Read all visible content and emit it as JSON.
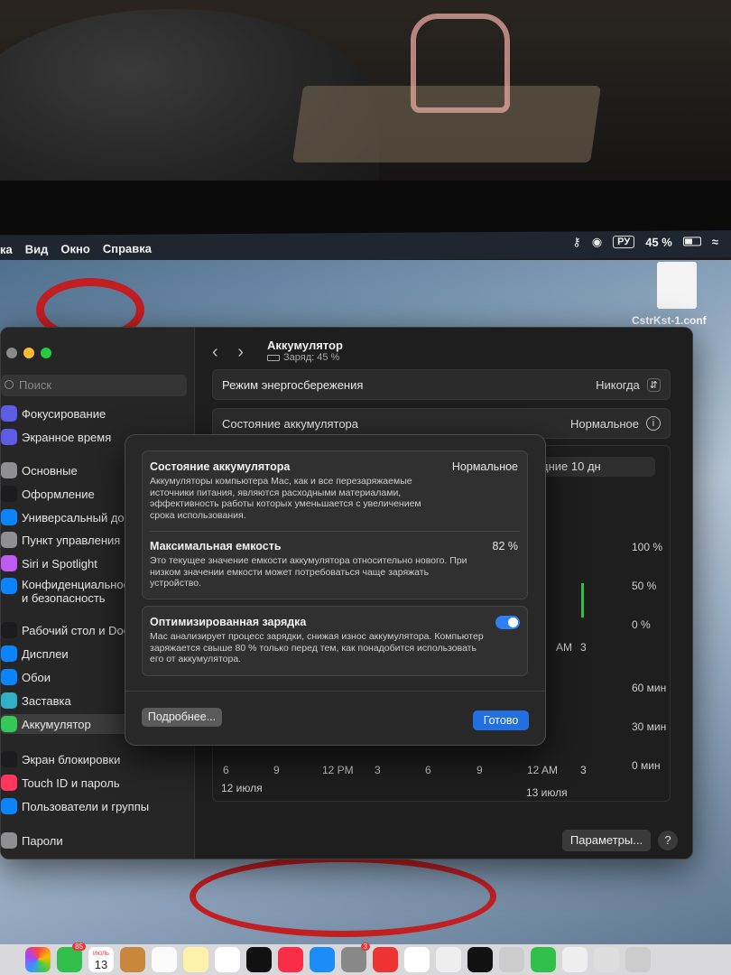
{
  "menubar": {
    "items": [
      "ка",
      "Вид",
      "Окно",
      "Справка"
    ],
    "input_language": "РУ",
    "battery_percent": "45 %",
    "icons": [
      "accessibility-icon",
      "notification-center-icon",
      "input-source-icon",
      "battery-icon",
      "wifi-icon"
    ]
  },
  "desktop": {
    "file_label": "CstrKst-1.conf"
  },
  "sidebar": {
    "search_placeholder": "Поиск",
    "items": [
      {
        "label": "Фокусирование",
        "icon": "moon-icon",
        "color": "#5e5ce6"
      },
      {
        "label": "Экранное время",
        "icon": "hourglass-icon",
        "color": "#5e5ce6"
      },
      {
        "label": "Основные",
        "icon": "gear-icon",
        "color": "#8e8e93"
      },
      {
        "label": "Оформление",
        "icon": "appearance-icon",
        "color": "#1c1c1e"
      },
      {
        "label": "Универсальный доступ",
        "icon": "accessibility-icon",
        "color": "#0a84ff"
      },
      {
        "label": "Пункт управления",
        "icon": "control-center-icon",
        "color": "#8e8e93"
      },
      {
        "label": "Siri и Spotlight",
        "icon": "siri-icon",
        "color": "#bf5af2"
      },
      {
        "label": "Конфиденциальность\nи безопасность",
        "icon": "hand-icon",
        "color": "#0a84ff"
      },
      {
        "label": "Рабочий стол и Dock",
        "icon": "dock-icon",
        "color": "#1c1c1e"
      },
      {
        "label": "Дисплеи",
        "icon": "sun-icon",
        "color": "#0a84ff"
      },
      {
        "label": "Обои",
        "icon": "wallpaper-icon",
        "color": "#0a84ff"
      },
      {
        "label": "Заставка",
        "icon": "screensaver-icon",
        "color": "#30b0c7"
      },
      {
        "label": "Аккумулятор",
        "icon": "battery-icon",
        "color": "#34c759"
      },
      {
        "label": "Экран блокировки",
        "icon": "lock-icon",
        "color": "#1c1c1e"
      },
      {
        "label": "Touch ID и пароль",
        "icon": "fingerprint-icon",
        "color": "#ff375f"
      },
      {
        "label": "Пользователи и группы",
        "icon": "users-icon",
        "color": "#0a84ff"
      },
      {
        "label": "Пароли",
        "icon": "key-icon",
        "color": "#8e8e93"
      }
    ]
  },
  "main": {
    "title": "Аккумулятор",
    "subtitle": "Заряд: 45 %",
    "low_power_label": "Режим энергосбережения",
    "low_power_value": "Никогда",
    "health_label": "Состояние аккумулятора",
    "health_value": "Нормальное",
    "range_tab": "дние 10 дн",
    "y_level_labels": [
      "100 %",
      "50 %",
      "0 %"
    ],
    "y_time_labels": [
      "60 мин",
      "30 мин",
      "0 мин"
    ],
    "x_labels": [
      "6",
      "9",
      "12 PM",
      "3",
      "6",
      "9",
      "12 AM",
      "3"
    ],
    "x_upper_labels": [
      "AM",
      "3"
    ],
    "dates": [
      "12 июля",
      "13 июля"
    ],
    "params_button": "Параметры...",
    "help_button": "?"
  },
  "sheet": {
    "health_title": "Состояние аккумулятора",
    "health_value": "Нормальное",
    "health_desc": "Аккумуляторы компьютера Mac, как и все перезаряжаемые источники питания, являются расходными материалами, эффективность работы которых уменьшается с увеличением срока использования.",
    "capacity_title": "Максимальная емкость",
    "capacity_value": "82 %",
    "capacity_desc": "Это текущее значение емкости аккумулятора относительно нового. При низком значении емкости может потребоваться чаще заряжать устройство.",
    "optimized_title": "Оптимизированная зарядка",
    "optimized_on": true,
    "optimized_desc": "Mac анализирует процесс зарядки, снижая износ аккумулятора. Компьютер заряжается свыше 80 % только перед тем, как понадобится использовать его от аккумулятора.",
    "more_button": "Подробнее...",
    "done_button": "Готово"
  },
  "dock": {
    "calendar_month": "ИЮЛЬ",
    "calendar_day": "13",
    "facetime_badge": "85",
    "badge_2": "3"
  }
}
